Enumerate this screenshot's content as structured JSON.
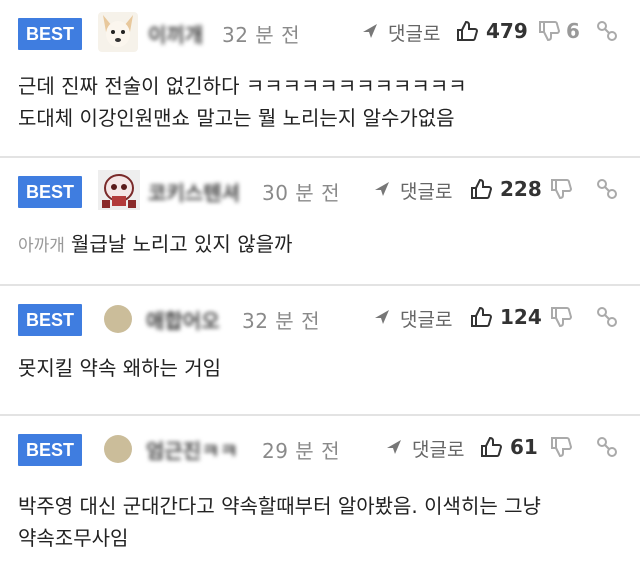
{
  "comments": [
    {
      "badge": "BEST",
      "nickname": "이끼개",
      "time": "32 분 전",
      "reply_label": "댓글로",
      "likes": "479",
      "dislikes": "6",
      "avatar": "dog-avatar",
      "lines": [
        "근데 진짜 전술이 없긴하다 ㅋㅋㅋㅋㅋㅋㅋㅋㅋㅋㅋㅋ",
        "도대체 이강인원맨쇼 말고는 뭘 노리는지 알수가없음"
      ]
    },
    {
      "badge": "BEST",
      "nickname": "코키스텐셔",
      "time": "30 분 전",
      "reply_label": "댓글로",
      "likes": "228",
      "dislikes": "",
      "avatar": "skull-avatar",
      "mention": "아까개",
      "lines": [
        "월급날 노리고 있지 않을까"
      ]
    },
    {
      "badge": "BEST",
      "nickname": "애합어오",
      "time": "32 분 전",
      "reply_label": "댓글로",
      "likes": "124",
      "dislikes": "",
      "avatar": "dot-avatar",
      "lines": [
        "못지킬 약속 왜하는 거임"
      ]
    },
    {
      "badge": "BEST",
      "nickname": "엄근진ㅋㅋ",
      "time": "29 분 전",
      "reply_label": "댓글로",
      "likes": "61",
      "dislikes": "",
      "avatar": "dot-avatar",
      "lines": [
        "박주영 대신 군대간다고 약속할때부터 알아봤음. 이색히는 그냥",
        "약속조무사임"
      ]
    }
  ],
  "colors": {
    "badge": "#3f7de0",
    "divider": "#e3e3e3",
    "muted": "#8a8a8a"
  }
}
